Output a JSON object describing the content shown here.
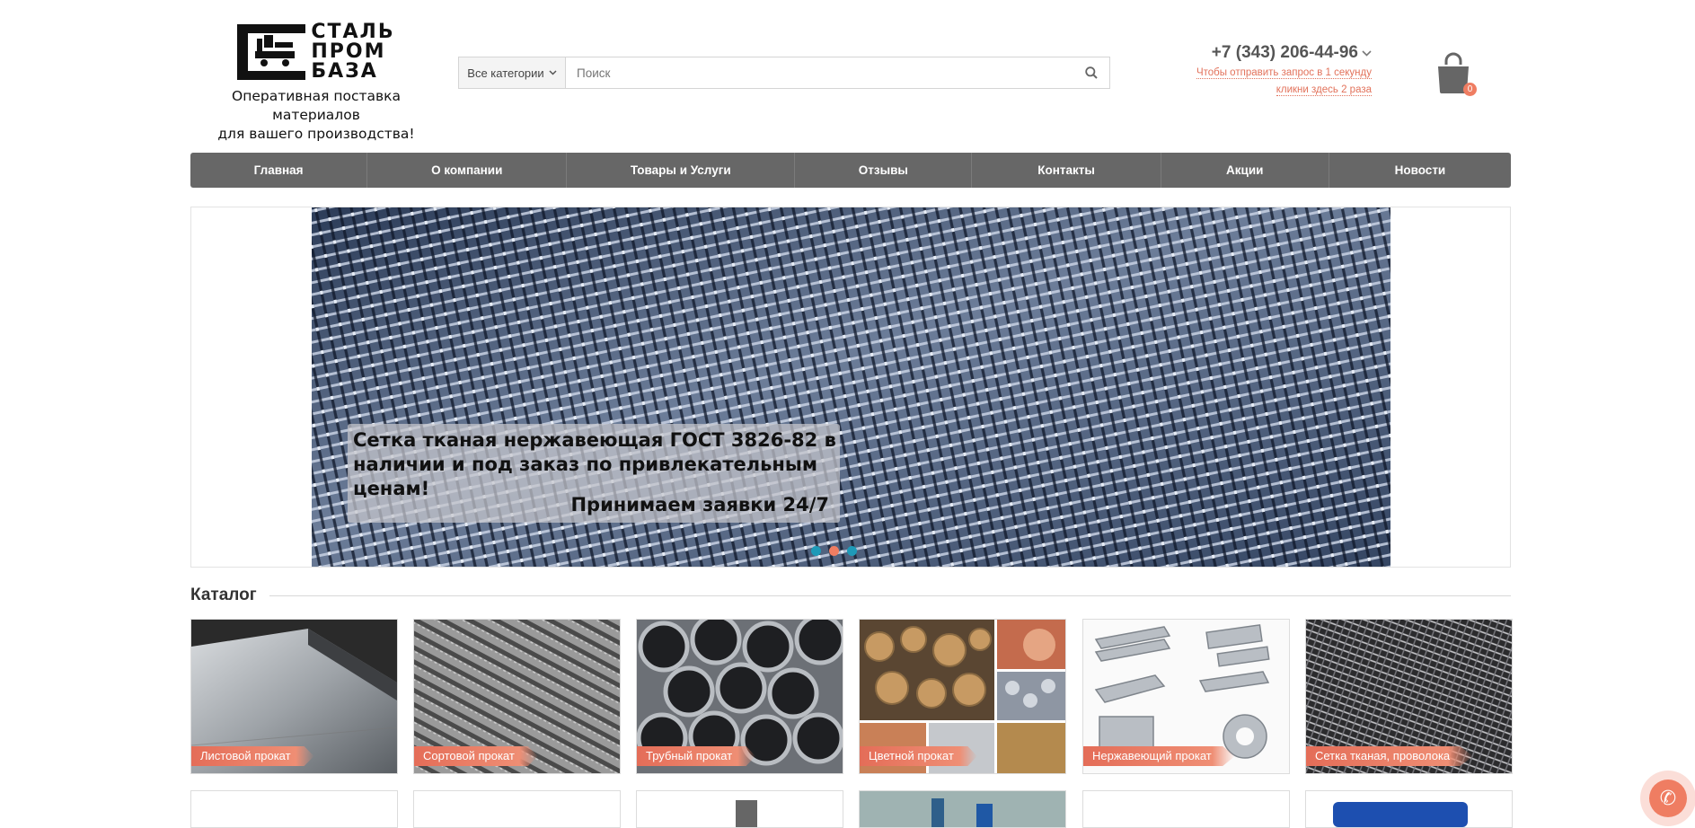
{
  "header": {
    "logo_lines": [
      "СТАЛЬ",
      "ПРОМ",
      "БАЗА"
    ],
    "tagline_line1": "Оперативная поставка материалов",
    "tagline_line2": "для вашего производства!",
    "search": {
      "category_label": "Все категории",
      "placeholder": "Поиск"
    },
    "phone": "+7 (343) 206-44-96",
    "callback_line1": "Чтобы отправить запрос в 1 секунду",
    "callback_line2": "кликни здесь 2 раза",
    "cart_count": "0"
  },
  "nav": {
    "items": [
      {
        "label": "Главная"
      },
      {
        "label": "О компании"
      },
      {
        "label": "Товары и Услуги"
      },
      {
        "label": "Отзывы"
      },
      {
        "label": "Контакты"
      },
      {
        "label": "Акции"
      },
      {
        "label": "Новости"
      }
    ]
  },
  "slider": {
    "caption_line1": "Сетка тканая нержавеющая ГОСТ 3826-82 в наличии и под заказ по привлекательным ценам!",
    "caption_line2": "Принимаем заявки 24/7",
    "active_dot": 2,
    "dot_count": 3
  },
  "catalog": {
    "title": "Каталог",
    "tiles": [
      {
        "label": "Листовой прокат"
      },
      {
        "label": "Сортовой прокат"
      },
      {
        "label": "Трубный прокат"
      },
      {
        "label": "Цветной прокат"
      },
      {
        "label": "Нержавеющий прокат"
      },
      {
        "label": "Сетка тканая, проволока"
      }
    ]
  },
  "colors": {
    "accent": "#ef7d62",
    "nav_bg": "#676767",
    "dot": "#1e9ab8"
  },
  "icons": {
    "search": "search-icon",
    "cart": "shopping-bag-icon",
    "phone_dropdown": "chevron-down-icon",
    "call": "phone-icon"
  }
}
